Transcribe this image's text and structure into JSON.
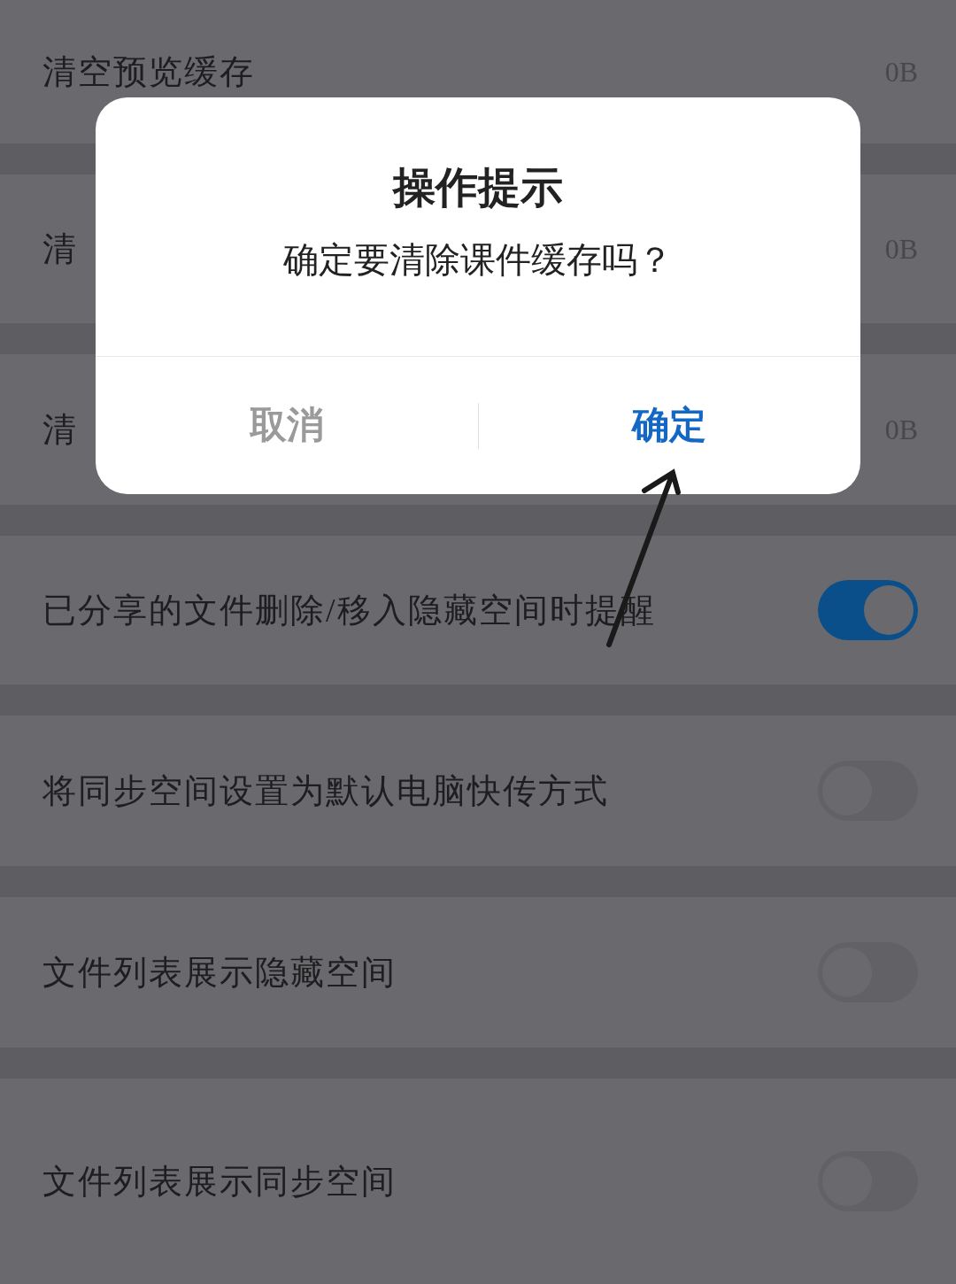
{
  "settings": [
    {
      "kind": "value",
      "label": "清空预览缓存",
      "value": "0B"
    },
    {
      "kind": "value",
      "label": "清",
      "value": "0B"
    },
    {
      "kind": "value",
      "label": "清",
      "value": "0B"
    },
    {
      "kind": "toggle",
      "label": "已分享的文件删除/移入隐藏空间时提醒",
      "on": true
    },
    {
      "kind": "toggle",
      "label": "将同步空间设置为默认电脑快传方式",
      "on": false
    },
    {
      "kind": "toggle",
      "label": "文件列表展示隐藏空间",
      "on": false
    },
    {
      "kind": "toggle",
      "label": "文件列表展示同步空间",
      "on": false
    }
  ],
  "dialog": {
    "title": "操作提示",
    "message": "确定要清除课件缓存吗？",
    "buttons": [
      {
        "kind": "cancel",
        "label": "取消"
      },
      {
        "kind": "confirm",
        "label": "确定"
      }
    ]
  }
}
